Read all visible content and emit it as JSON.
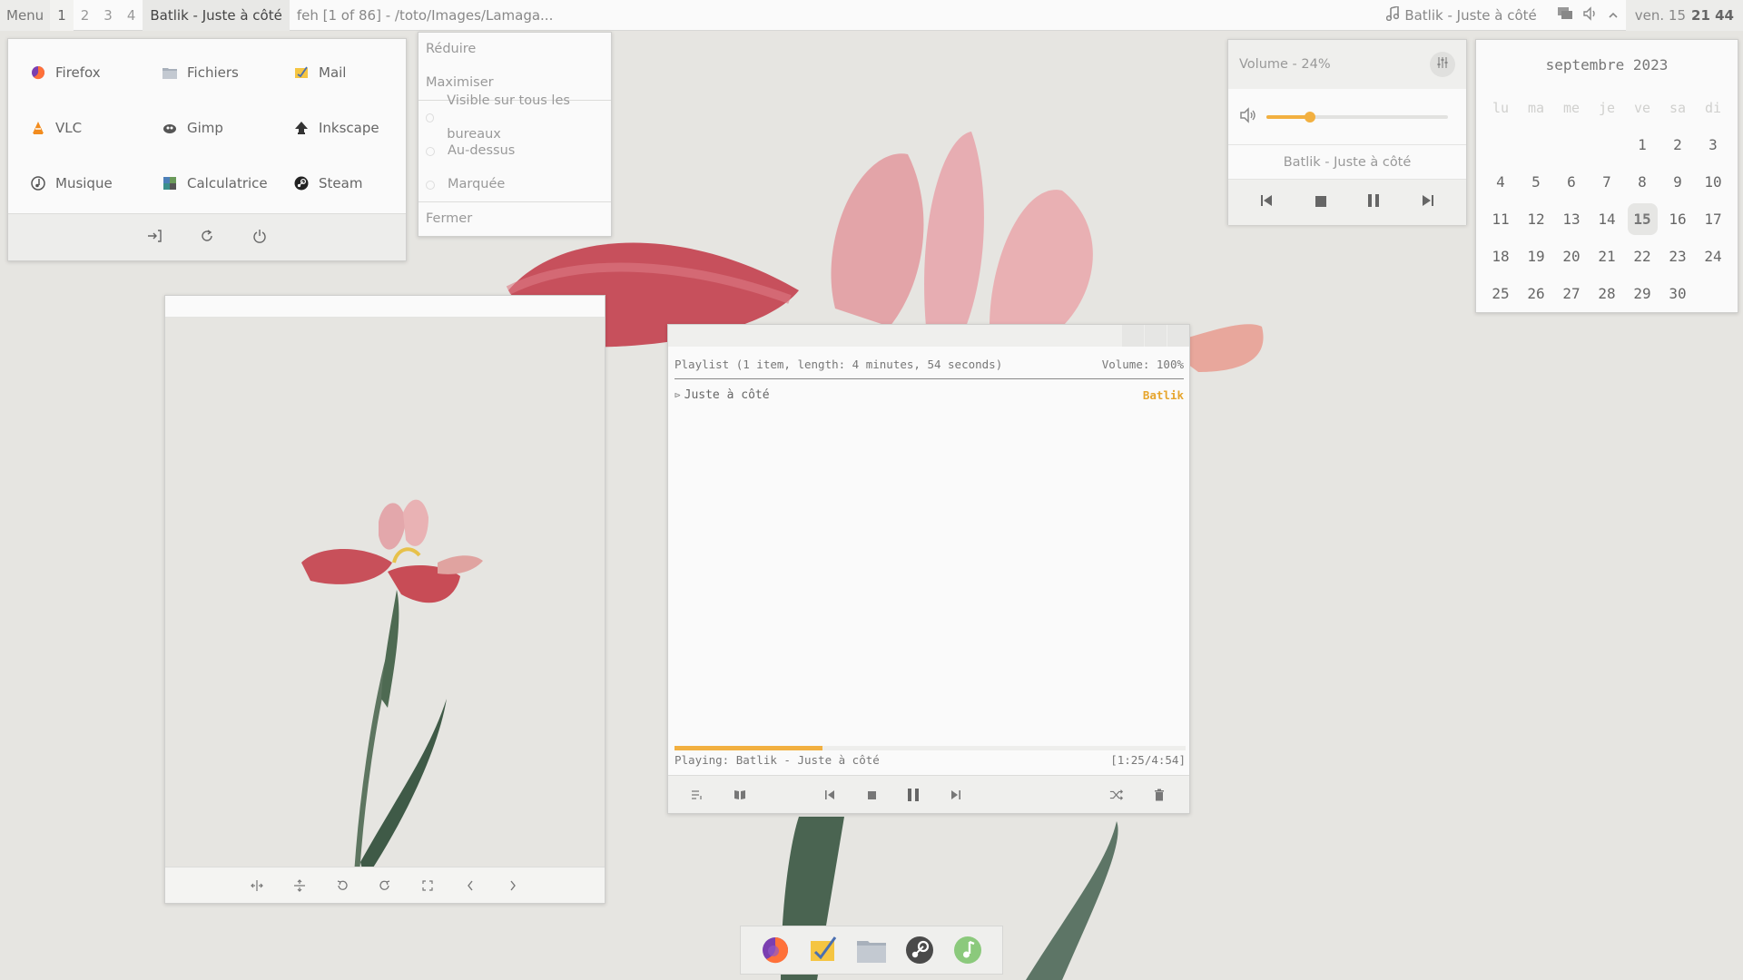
{
  "topbar": {
    "menu_label": "Menu",
    "workspaces": [
      "1",
      "2",
      "3",
      "4"
    ],
    "active_workspace": "1",
    "active_task": "Batlik - Juste à côté",
    "task": "feh [1 of 86] - /toto/Images/Lamaga...",
    "now_playing": "Batlik - Juste à côté",
    "date": "ven. 15",
    "time": "21 44"
  },
  "launcher": {
    "apps": [
      {
        "label": "Firefox",
        "icon": "firefox-icon"
      },
      {
        "label": "Fichiers",
        "icon": "folder-icon"
      },
      {
        "label": "Mail",
        "icon": "mail-icon"
      },
      {
        "label": "VLC",
        "icon": "vlc-icon"
      },
      {
        "label": "Gimp",
        "icon": "gimp-icon"
      },
      {
        "label": "Inkscape",
        "icon": "inkscape-icon"
      },
      {
        "label": "Musique",
        "icon": "music-icon"
      },
      {
        "label": "Calculatrice",
        "icon": "calculator-icon"
      },
      {
        "label": "Steam",
        "icon": "steam-icon"
      }
    ],
    "footer_icons": [
      "logout-icon",
      "restart-icon",
      "power-icon"
    ]
  },
  "context_menu": {
    "items": [
      {
        "label": "Réduire",
        "type": "action"
      },
      {
        "label": "Maximiser",
        "type": "action"
      },
      {
        "label": "Visible sur tous les bureaux",
        "type": "check"
      },
      {
        "label": "Au-dessus",
        "type": "check"
      },
      {
        "label": "Marquée",
        "type": "check"
      },
      {
        "label": "Fermer",
        "type": "action"
      }
    ]
  },
  "volume_popup": {
    "title": "Volume - 24%",
    "level": 0.24,
    "track": "Batlik - Juste à côté"
  },
  "calendar": {
    "month": "septembre 2023",
    "weekdays": [
      "lu",
      "ma",
      "me",
      "je",
      "ve",
      "sa",
      "di"
    ],
    "days": [
      [
        "",
        "",
        "",
        "",
        "1",
        "2",
        "3"
      ],
      [
        "4",
        "5",
        "6",
        "7",
        "8",
        "9",
        "10"
      ],
      [
        "11",
        "12",
        "13",
        "14",
        "15",
        "16",
        "17"
      ],
      [
        "18",
        "19",
        "20",
        "21",
        "22",
        "23",
        "24"
      ],
      [
        "25",
        "26",
        "27",
        "28",
        "29",
        "30",
        ""
      ]
    ],
    "today": "15"
  },
  "player": {
    "playlist_header": "Playlist (1 item, length: 4 minutes, 54 seconds)",
    "volume": "Volume: 100%",
    "tracks": [
      {
        "title": "Juste à côté",
        "artist": "Batlik"
      }
    ],
    "status": "Playing: Batlik - Juste à côté",
    "time": "[1:25/4:54]",
    "progress": 0.289
  },
  "colors": {
    "accent": "#f2b040",
    "artist": "#e6a52d",
    "background": "#e6e5e1"
  }
}
